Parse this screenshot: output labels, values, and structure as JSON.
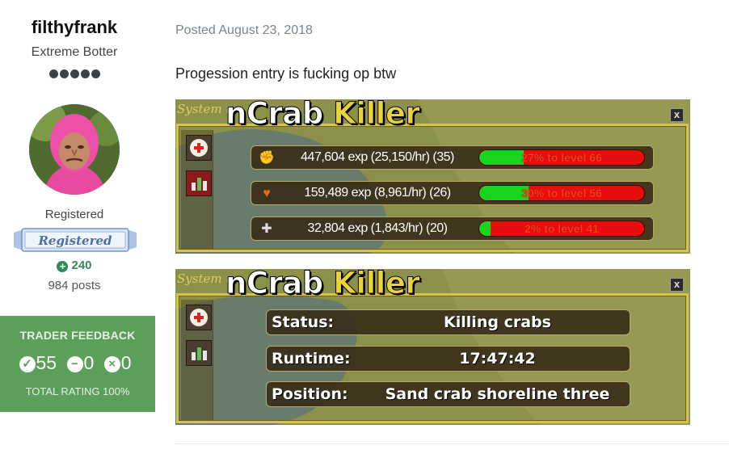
{
  "author": {
    "name": "filthyfrank",
    "title": "Extreme Botter",
    "rank_pips": 5,
    "group": "Registered",
    "group_badge_text": "Registered",
    "reputation": "240",
    "posts": "984 posts"
  },
  "feedback": {
    "title": "TRADER FEEDBACK",
    "positive": "55",
    "neutral": "0",
    "negative": "0",
    "total": "TOTAL RATING 100%"
  },
  "post": {
    "date": "Posted August 23, 2018",
    "text": "Progession entry is fucking op btw"
  },
  "game_panels": [
    {
      "small_title": "System u",
      "title_part1": "nCrab",
      "title_part2": "Killer",
      "close_label": "x",
      "rows": [
        {
          "icon": "strength-fist-icon",
          "text": "447,604 exp (25,150/hr) (35)",
          "progress_label": "27% to level 66",
          "progress": 0.27
        },
        {
          "icon": "heart-icon",
          "text": "159,489 exp (8,961/hr) (26)",
          "progress_label": "30% to level 56",
          "progress": 0.3
        },
        {
          "icon": "defence-cross-icon",
          "text": "32,804 exp (1,843/hr) (20)",
          "progress_label": "2% to level 41",
          "progress": 0.02
        }
      ]
    },
    {
      "small_title": "System u",
      "title_part1": "nCrab",
      "title_part2": "Killer",
      "close_label": "x",
      "rows": [
        {
          "label": "Status:",
          "value": "Killing crabs"
        },
        {
          "label": "Runtime:",
          "value": "17:47:42"
        },
        {
          "label": "Position:",
          "value": "Sand crab shoreline three"
        }
      ]
    }
  ],
  "colors": {
    "accent_green": "#5c9f5b",
    "rep_green": "#2d8c5a",
    "progress_green": "#19d41d",
    "progress_red": "#e80e0e",
    "title_gold": "#e9d23a"
  }
}
